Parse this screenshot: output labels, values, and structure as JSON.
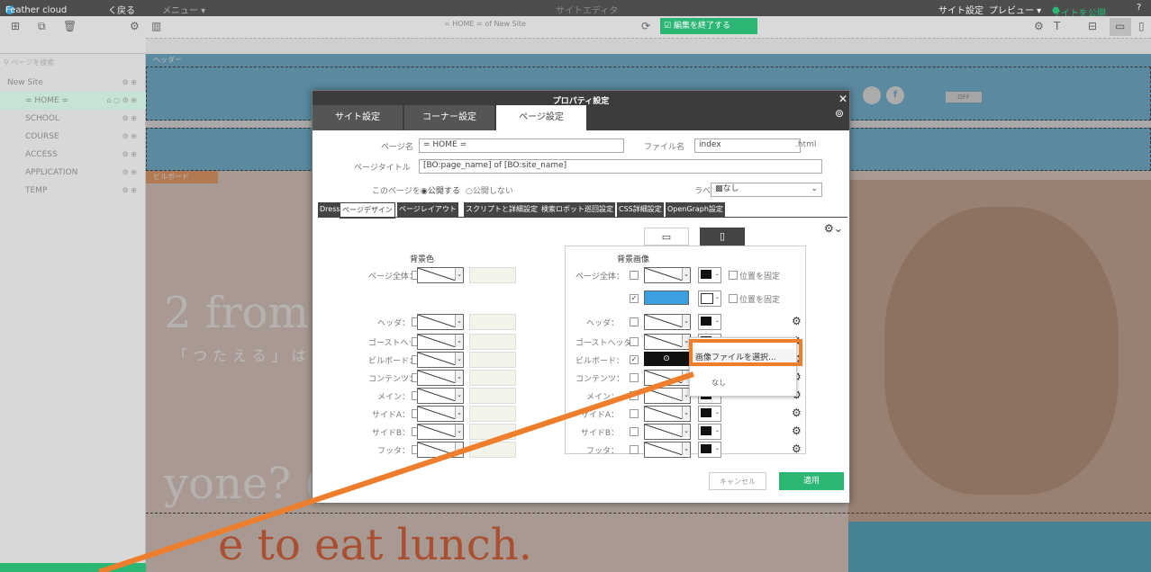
{
  "topbar": {
    "logo": "Feather cloud",
    "back": "く戻る",
    "menu": "メニュー ▾",
    "center": "サイトエディタ",
    "site_settings": "サイト設定",
    "preview": "プレビュー ▾",
    "publish": "サイトを公開",
    "help": "?"
  },
  "toolbar": {
    "url": "= HOME = of New Site",
    "finish_edit": "編集を終了する"
  },
  "sidebar": {
    "search_placeholder": "ページを検索",
    "root": "New Site",
    "items": [
      {
        "label": "= HOME ="
      },
      {
        "label": "SCHOOL"
      },
      {
        "label": "COURSE"
      },
      {
        "label": "ACCESS"
      },
      {
        "label": "APPLICATION"
      },
      {
        "label": "TEMP"
      }
    ]
  },
  "canvas": {
    "header_tag": "ヘッダー",
    "billboard_tag": "ビルボード",
    "hand_text_1": "2 from",
    "hand_text_2": "yone? (",
    "hand_text_3": "e to eat lunch.",
    "hand_text_4": "「つたえる」は",
    "off_badge": "OFF"
  },
  "modal": {
    "title": "プロパティ設定",
    "tabs": [
      "サイト設定",
      "コーナー設定",
      "ページ設定"
    ],
    "page_name_label": "ページ名",
    "page_name_value": "= HOME =",
    "file_name_label": "ファイル名",
    "file_name_value": "index",
    "file_ext": ".html",
    "page_title_label": "ページタイトル",
    "page_title_value": "[BO:page_name] of [BO:site_name]",
    "publish_label": "このページを",
    "publish_on": "公開する",
    "publish_off": "公開しない",
    "label_label": "ラベル",
    "label_value": "なし",
    "subtabs": [
      "Dress",
      "ページデザイン",
      "ページレイアウト",
      "スクリプトと詳細設定",
      "検索ロボット巡回設定",
      "CSS詳細設定",
      "OpenGraph設定"
    ],
    "bg_color_title": "背景色",
    "bg_image_title": "背景画像",
    "rows": [
      "ページ全体：",
      "ヘッダ：",
      "ゴーストヘッダ：",
      "ビルボード：",
      "コンテンツ：",
      "メイン：",
      "サイドA：",
      "サイドB：",
      "フッタ："
    ],
    "fix_position": "位置を固定",
    "context_menu": {
      "choose_image": "画像ファイルを選択...",
      "none": "なし"
    },
    "cancel": "キャンセル",
    "apply": "適用"
  },
  "colors": {
    "accent_green": "#2bb673",
    "highlight_orange": "#ee7d2c",
    "header_blue": "#6ab3d6"
  }
}
